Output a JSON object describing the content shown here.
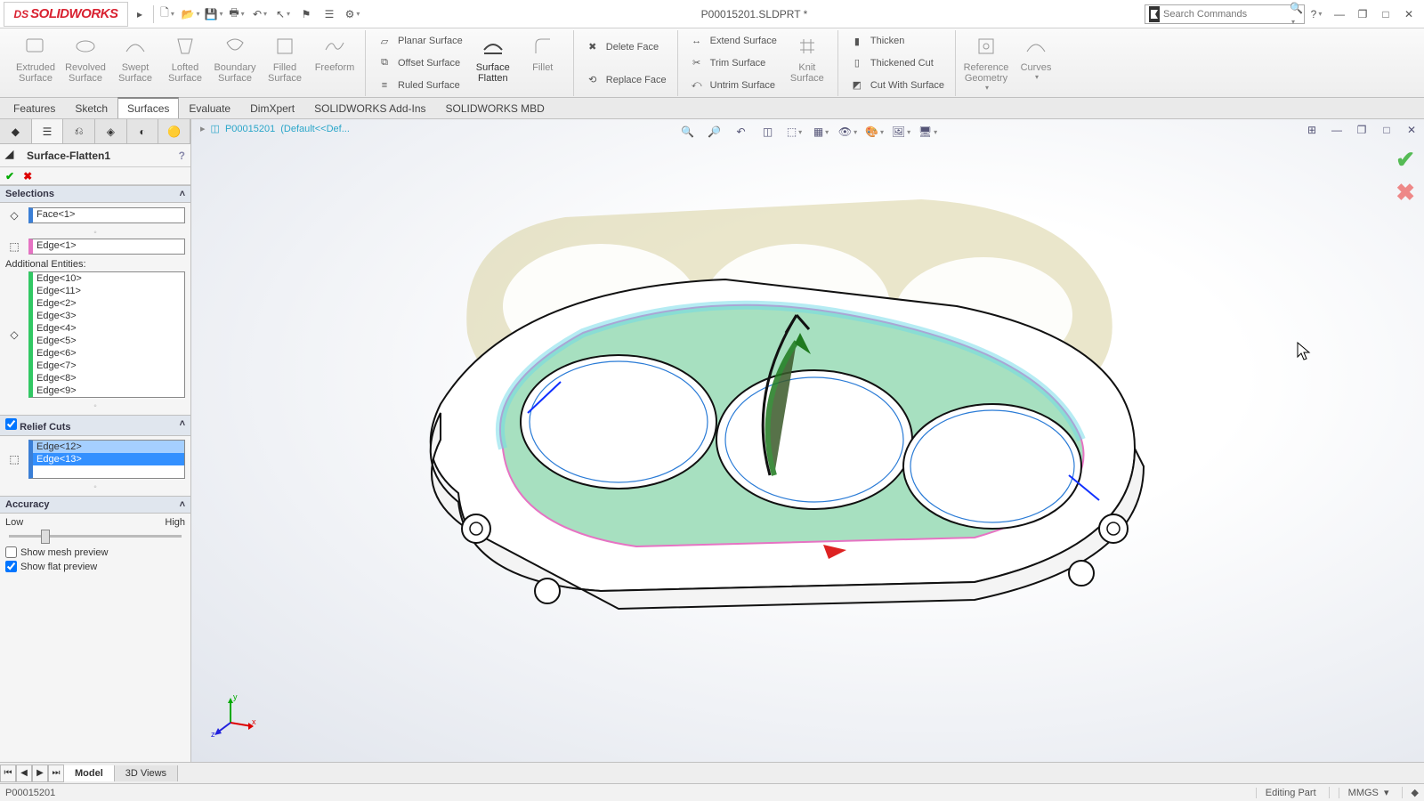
{
  "app": {
    "name": "SOLIDWORKS",
    "title": "P00015201.SLDPRT *"
  },
  "search": {
    "placeholder": "Search Commands"
  },
  "ribbon": {
    "big": [
      {
        "label": "Extruded Surface"
      },
      {
        "label": "Revolved Surface"
      },
      {
        "label": "Swept Surface"
      },
      {
        "label": "Lofted Surface"
      },
      {
        "label": "Boundary Surface"
      },
      {
        "label": "Filled Surface"
      },
      {
        "label": "Freeform"
      }
    ],
    "col2": [
      {
        "label": "Planar Surface"
      },
      {
        "label": "Offset Surface"
      },
      {
        "label": "Ruled Surface"
      }
    ],
    "flattenfillet": [
      {
        "label": "Surface Flatten"
      },
      {
        "label": "Fillet"
      }
    ],
    "col3": [
      {
        "label": "Delete Face"
      },
      {
        "label": "Replace Face"
      }
    ],
    "col4": [
      {
        "label": "Extend Surface"
      },
      {
        "label": "Trim Surface"
      },
      {
        "label": "Untrim Surface"
      }
    ],
    "knit": {
      "label": "Knit Surface"
    },
    "col5": [
      {
        "label": "Thicken"
      },
      {
        "label": "Thickened Cut"
      },
      {
        "label": "Cut With Surface"
      }
    ],
    "refgeom": {
      "label": "Reference Geometry"
    },
    "curves": {
      "label": "Curves"
    }
  },
  "tabs": [
    "Features",
    "Sketch",
    "Surfaces",
    "Evaluate",
    "DimXpert",
    "SOLIDWORKS Add-Ins",
    "SOLIDWORKS MBD"
  ],
  "tabs_active": 2,
  "breadcrumb": {
    "doc": "P00015201",
    "config": "(Default<<Def..."
  },
  "panel": {
    "title": "Surface-Flatten1",
    "sections": {
      "selections": "Selections",
      "additional": "Additional Entities:",
      "relief": "Relief Cuts",
      "accuracy": "Accuracy"
    },
    "face_list": [
      "Face<1>"
    ],
    "edge_list_main": [
      "Edge<1>"
    ],
    "edge_list_additional": [
      "Edge<10>",
      "Edge<11>",
      "Edge<2>",
      "Edge<3>",
      "Edge<4>",
      "Edge<5>",
      "Edge<6>",
      "Edge<7>",
      "Edge<8>",
      "Edge<9>"
    ],
    "relief_checked": true,
    "relief_list": [
      "Edge<12>",
      "Edge<13>"
    ],
    "accuracy_low": "Low",
    "accuracy_high": "High",
    "show_mesh": {
      "label": "Show mesh preview",
      "checked": false
    },
    "show_flat": {
      "label": "Show flat preview",
      "checked": true
    }
  },
  "bottom_tabs": [
    "Model",
    "3D Views"
  ],
  "bottom_active": 0,
  "status": {
    "left": "P00015201",
    "editing": "Editing Part",
    "units": "MMGS"
  },
  "colors": {
    "accent_red": "#d92231",
    "link_teal": "#2aa6c9"
  }
}
